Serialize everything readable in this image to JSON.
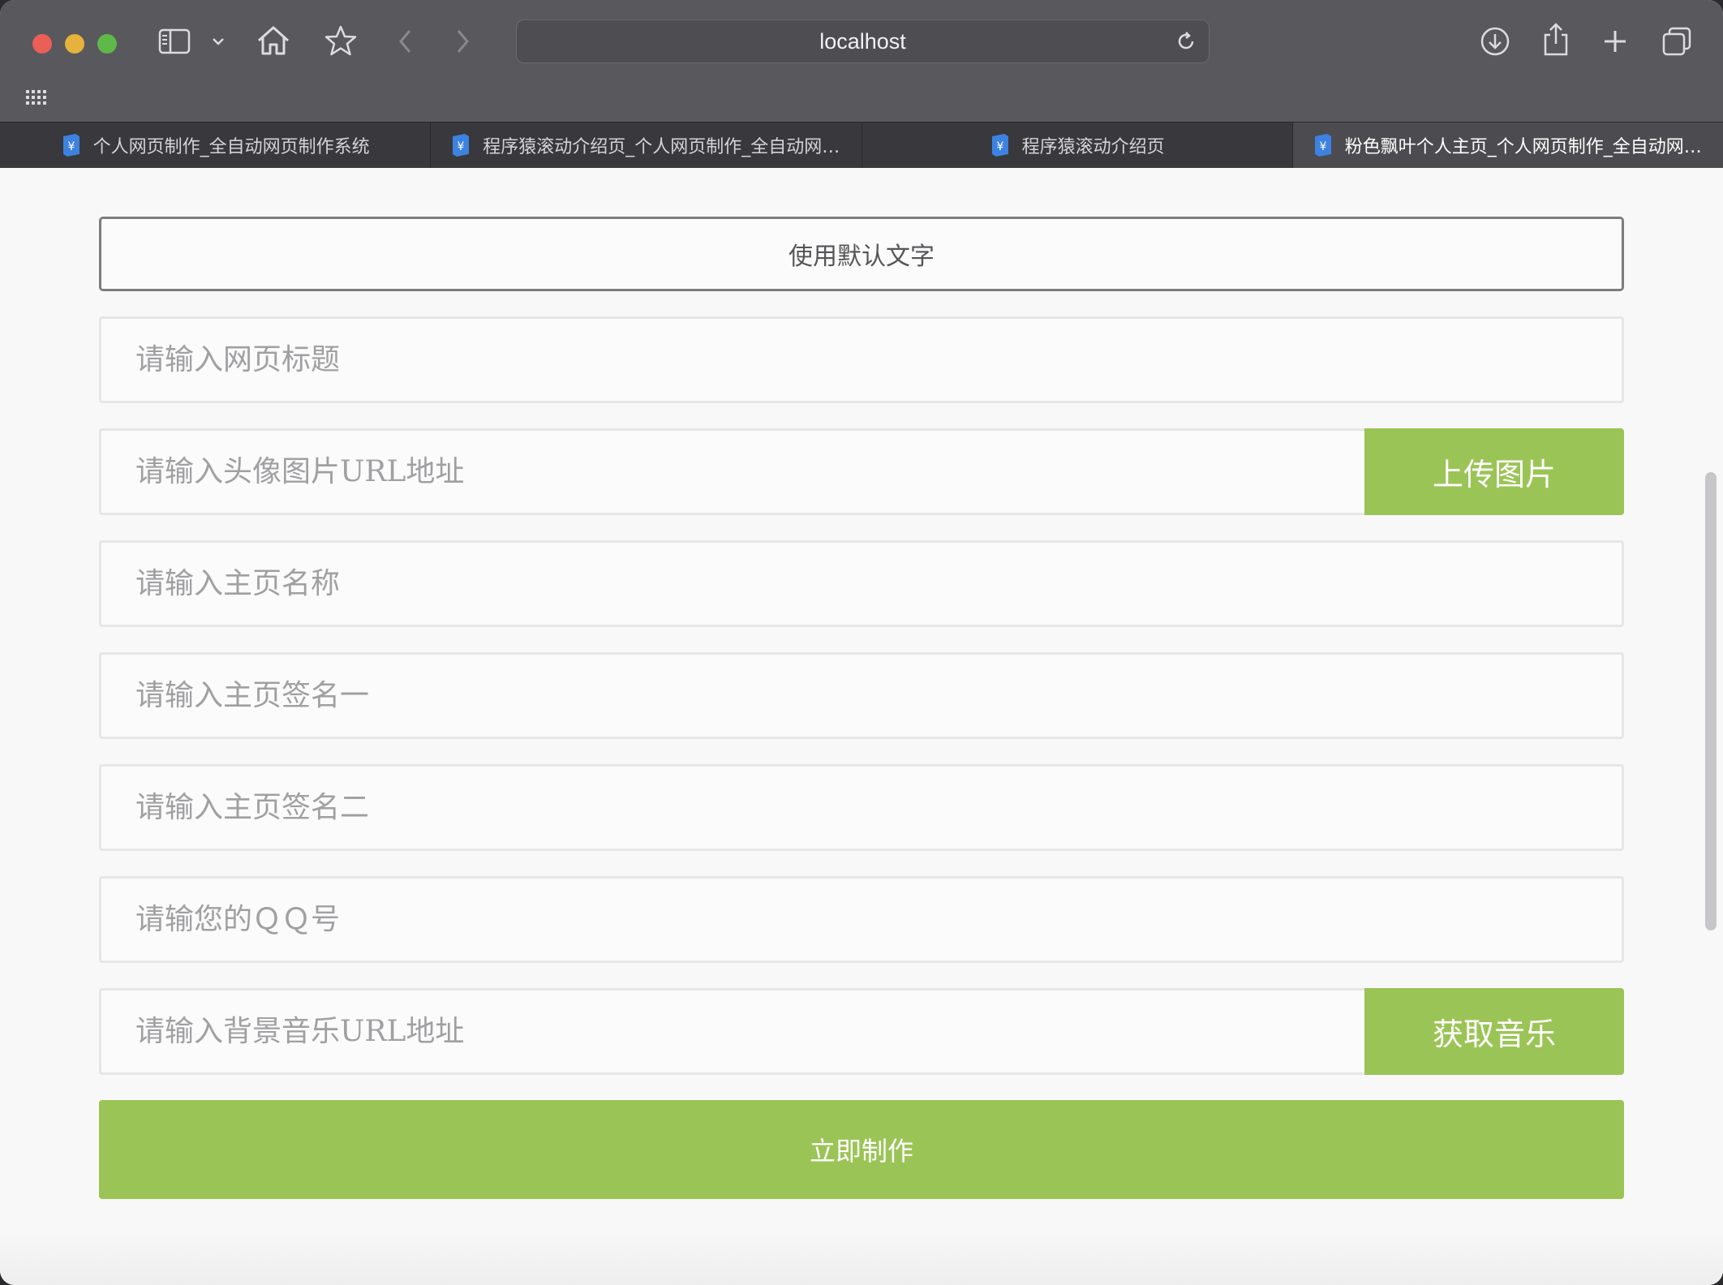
{
  "browser": {
    "address": "localhost",
    "icons": {
      "sidebar": "sidebar-icon",
      "home": "home-icon",
      "bookmark": "star-icon",
      "back": "chevron-left-icon",
      "forward": "chevron-right-icon",
      "reload": "reload-icon",
      "download": "download-icon",
      "share": "share-icon",
      "new_tab": "plus-icon",
      "tab_overview": "tabs-overview-icon",
      "apps": "grid-icon"
    },
    "tabs": [
      {
        "label": "个人网页制作_全自动网页制作系统",
        "active": false
      },
      {
        "label": "程序猿滚动介绍页_个人网页制作_全自动网页制作系统",
        "active": false
      },
      {
        "label": "程序猿滚动介绍页",
        "active": false
      },
      {
        "label": "粉色飘叶个人主页_个人网页制作_全自动网页制作系统",
        "active": true
      }
    ]
  },
  "form": {
    "default_text_button": "使用默认文字",
    "fields": [
      {
        "placeholder": "请输入网页标题",
        "value": ""
      },
      {
        "placeholder": "请输入头像图片URL地址",
        "value": "",
        "button": "上传图片"
      },
      {
        "placeholder": "请输入主页名称",
        "value": ""
      },
      {
        "placeholder": "请输入主页签名一",
        "value": ""
      },
      {
        "placeholder": "请输入主页签名二",
        "value": ""
      },
      {
        "placeholder": "请输您的ＱＱ号",
        "value": ""
      },
      {
        "placeholder": "请输入背景音乐URL地址",
        "value": "",
        "button": "获取音乐"
      }
    ],
    "submit_button": "立即制作"
  },
  "colors": {
    "accent": "#9bc456",
    "toolbar": "#59585c",
    "tabbar": "#39383c",
    "page_bg": "#f8f8f9"
  }
}
